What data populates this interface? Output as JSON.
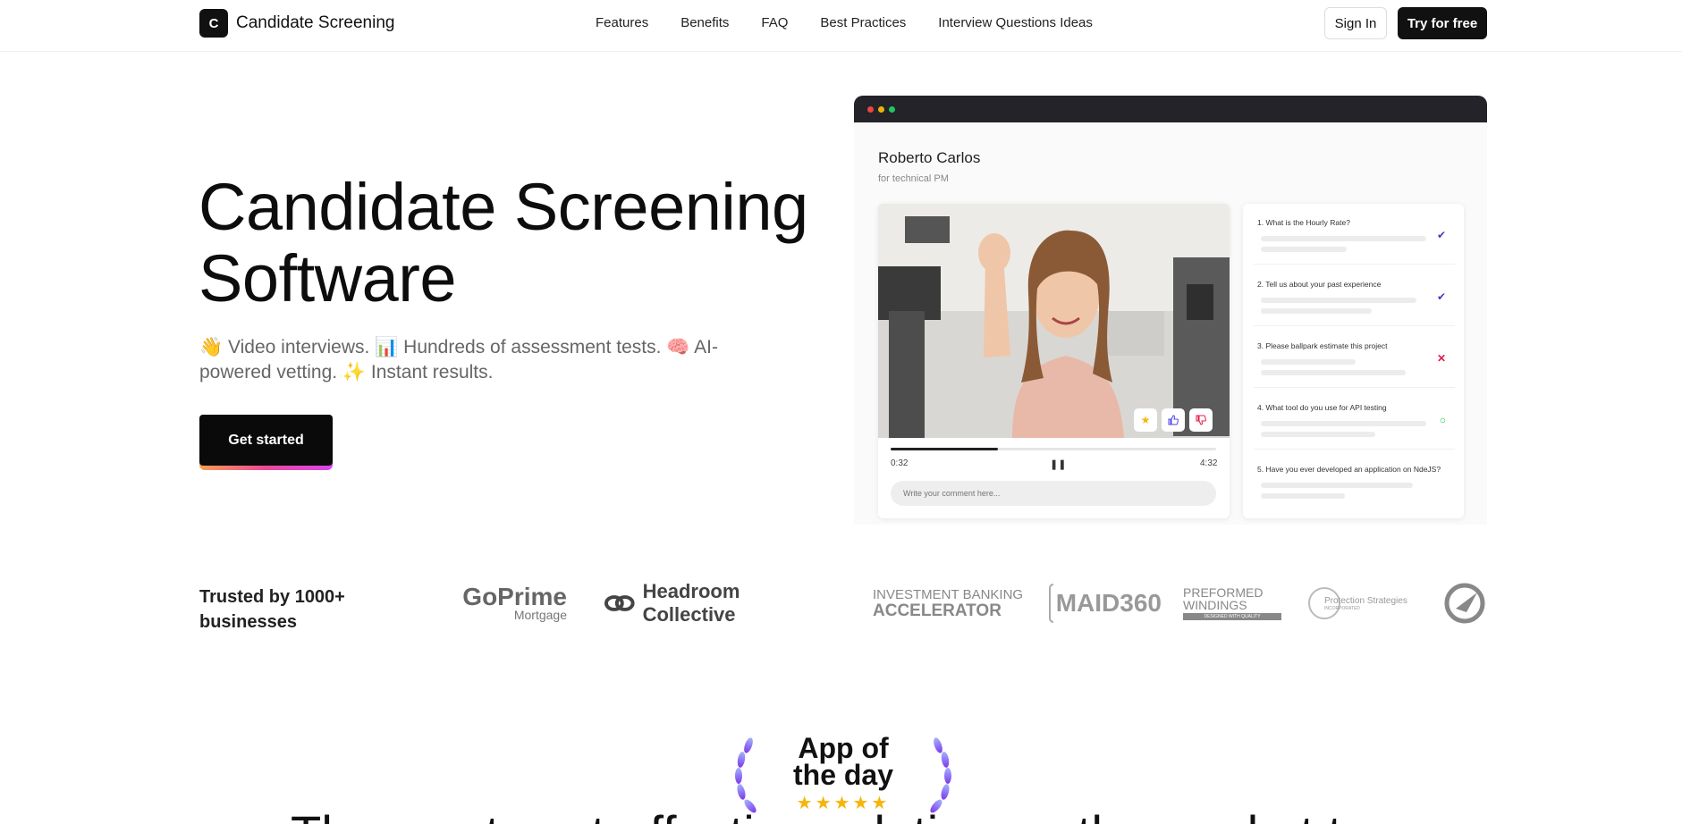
{
  "brand": {
    "logo_letter": "C",
    "name": "Candidate Screening"
  },
  "nav": {
    "links": [
      "Features",
      "Benefits",
      "FAQ",
      "Best Practices",
      "Interview Questions Ideas"
    ],
    "signin_label": "Sign In",
    "try_label": "Try for free"
  },
  "hero": {
    "title_line1": "Candidate Screening",
    "title_line2": "Software",
    "subtitle": "👋 Video interviews. 📊 Hundreds of assessment tests. 🧠 AI-powered vetting. ✨ Instant results.",
    "cta_label": "Get started"
  },
  "mock": {
    "candidate_name": "Roberto Carlos",
    "candidate_role": "for technical PM",
    "current_time": "0:32",
    "duration": "4:32",
    "progress_fraction": 0.33,
    "comment_placeholder": "Write your comment here...",
    "questions": [
      {
        "text": "1. What is the Hourly Rate?",
        "status": "check"
      },
      {
        "text": "2. Tell us about your past experience",
        "status": "check"
      },
      {
        "text": "3. Please ballpark estimate this project",
        "status": "cross"
      },
      {
        "text": "4. What tool do you use for API testing",
        "status": "pending"
      },
      {
        "text": "5. Have you ever developed an application on NdeJS?",
        "status": "none"
      }
    ],
    "colors": {
      "check": "#4338ca",
      "cross": "#e11d48",
      "pending": "#22c55e"
    }
  },
  "trusted": {
    "label": "Trusted by 1000+ businesses",
    "logos": [
      {
        "line1": "GoPrime",
        "line2": "Mortgage"
      },
      {
        "line1": "Headroom Collective"
      },
      {
        "line1": "INVESTMENT BANKING",
        "line2": "ACCELERATOR"
      },
      {
        "line1": "MAID360"
      },
      {
        "line1": "PREFORMED",
        "line2": "WINDINGS",
        "line3": "DESIGNED WITH QUALITY"
      },
      {
        "line1": "Protection Strategies",
        "line2": "INCORPORATED"
      }
    ]
  },
  "award": {
    "line1": "App of",
    "line2": "the day",
    "stars": "★★★★★"
  },
  "bottom_heading": "The most cost-effective solution on the market to"
}
